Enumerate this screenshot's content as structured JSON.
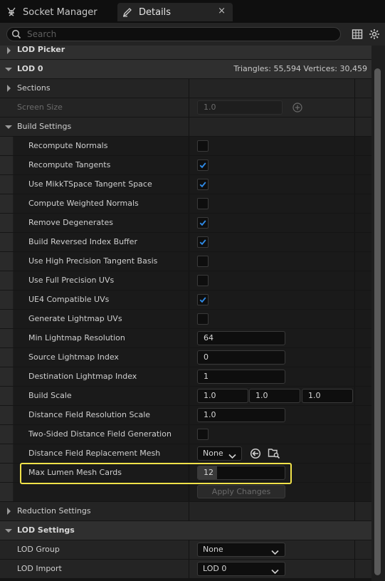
{
  "tabs": [
    {
      "label": "Socket Manager",
      "icon": "socket-icon"
    },
    {
      "label": "Details",
      "icon": "pencil-icon",
      "close": "×"
    }
  ],
  "search": {
    "placeholder": "Search"
  },
  "toolbar": {
    "icons": [
      "grid-view-icon",
      "settings-gear-icon"
    ]
  },
  "rows": {
    "lod_picker": "LOD Picker",
    "lod0": {
      "label": "LOD 0",
      "stats": "Triangles: 55,594   Vertices: 30,459"
    },
    "sections": "Sections",
    "screen_size": {
      "label": "Screen Size",
      "value": "1.0"
    },
    "build_settings": "Build Settings",
    "recompute_normals": {
      "label": "Recompute Normals",
      "checked": false
    },
    "recompute_tangents": {
      "label": "Recompute Tangents",
      "checked": true
    },
    "mikkt": {
      "label": "Use MikkTSpace Tangent Space",
      "checked": true
    },
    "weighted_normals": {
      "label": "Compute Weighted Normals",
      "checked": false
    },
    "remove_degenerates": {
      "label": "Remove Degenerates",
      "checked": true
    },
    "reversed_index": {
      "label": "Build Reversed Index Buffer",
      "checked": true
    },
    "high_precision_tangent": {
      "label": "Use High Precision Tangent Basis",
      "checked": false
    },
    "full_precision_uvs": {
      "label": "Use Full Precision UVs",
      "checked": false
    },
    "ue4_uvs": {
      "label": "UE4 Compatible UVs",
      "checked": true
    },
    "gen_lightmap_uvs": {
      "label": "Generate Lightmap UVs",
      "checked": false
    },
    "min_lightmap_res": {
      "label": "Min Lightmap Resolution",
      "value": "64"
    },
    "source_lightmap_index": {
      "label": "Source Lightmap Index",
      "value": "0"
    },
    "dest_lightmap_index": {
      "label": "Destination Lightmap Index",
      "value": "1"
    },
    "build_scale": {
      "label": "Build Scale",
      "x": "1.0",
      "y": "1.0",
      "z": "1.0"
    },
    "df_res_scale": {
      "label": "Distance Field Resolution Scale",
      "value": "1.0"
    },
    "two_sided_df": {
      "label": "Two-Sided Distance Field Generation",
      "checked": false
    },
    "df_replacement_mesh": {
      "label": "Distance Field Replacement Mesh",
      "value": "None"
    },
    "max_lumen_cards": {
      "label": "Max Lumen Mesh Cards",
      "value": "12",
      "fill": 0.22
    },
    "apply_changes": "Apply Changes",
    "reduction_settings": "Reduction Settings",
    "lod_settings": "LOD Settings",
    "lod_group": {
      "label": "LOD Group",
      "value": "None"
    },
    "lod_import": {
      "label": "LOD Import",
      "value": "LOD 0"
    }
  },
  "colors": {
    "accent_check": "#2f8ae6",
    "highlight": "#f1e24a"
  }
}
